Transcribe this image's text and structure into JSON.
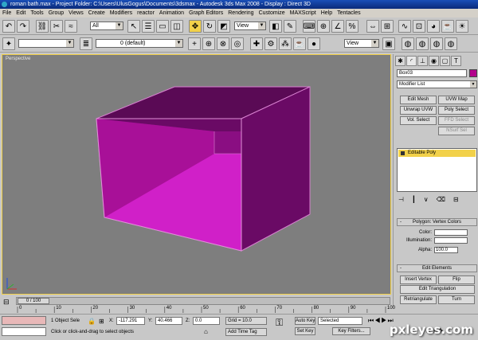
{
  "window": {
    "title": "roman bath.max  - Project Folder: C:\\Users\\UlusGogus\\Documents\\3dsmax     - Autodesk 3ds Max 2008     - Display : Direct 3D"
  },
  "menu": [
    "File",
    "Edit",
    "Tools",
    "Group",
    "Views",
    "Create",
    "Modifiers",
    "reactor",
    "Animation",
    "Graph Editors",
    "Rendering",
    "Customize",
    "MAXScript",
    "Help",
    "Tentacles"
  ],
  "toolbar": {
    "selection_filter": "All",
    "ref_coord": "View",
    "named_selection": "",
    "layer": "0 (default)",
    "view_dropdown": "View"
  },
  "viewport": {
    "label": "Perspective",
    "object_color": "#c018b8",
    "background": "#7e7e7e"
  },
  "command_panel": {
    "object_name": "Box03",
    "modifier_list": "Modifier List",
    "modifier_buttons": [
      "Edit Mesh",
      "UVW Map",
      "Unwrap UVW",
      "Poly Select",
      "Vol. Select",
      "FFD Select",
      "NSurf Sel"
    ],
    "stack_item": "Editable Poly",
    "rollout_vertex_colors": {
      "title": "Polygon: Vertex Colors",
      "color_label": "Color:",
      "illumination_label": "Illumination:",
      "alpha_label": "Alpha:",
      "alpha_value": "100.0"
    },
    "rollout_edit_elements": {
      "title": "Edit Elements",
      "insert_vertex": "Insert Vertex",
      "flip": "Flip",
      "edit_triangulation": "Edit Triangulation",
      "retriangulate": "Retriangulate",
      "turn": "Turn"
    }
  },
  "timeline": {
    "frame": "0 / 100",
    "ticks": [
      "0",
      "10",
      "20",
      "30",
      "40",
      "50",
      "60",
      "70",
      "80",
      "90",
      "100"
    ]
  },
  "status": {
    "selection": "1 Object Sele",
    "x_label": "X:",
    "x_value": "-117.291",
    "y_label": "Y:",
    "y_value": "40.466",
    "z_label": "Z:",
    "z_value": "0.0",
    "grid": "Grid = 10.0",
    "prompt": "Click or click-and-drag to select objects",
    "add_time_tag": "Add Time Tag",
    "auto_key": "Auto Key",
    "selected": "Selected",
    "set_key": "Set Key",
    "key_filters": "Key Filters..."
  },
  "watermark": "pxleyes.com"
}
